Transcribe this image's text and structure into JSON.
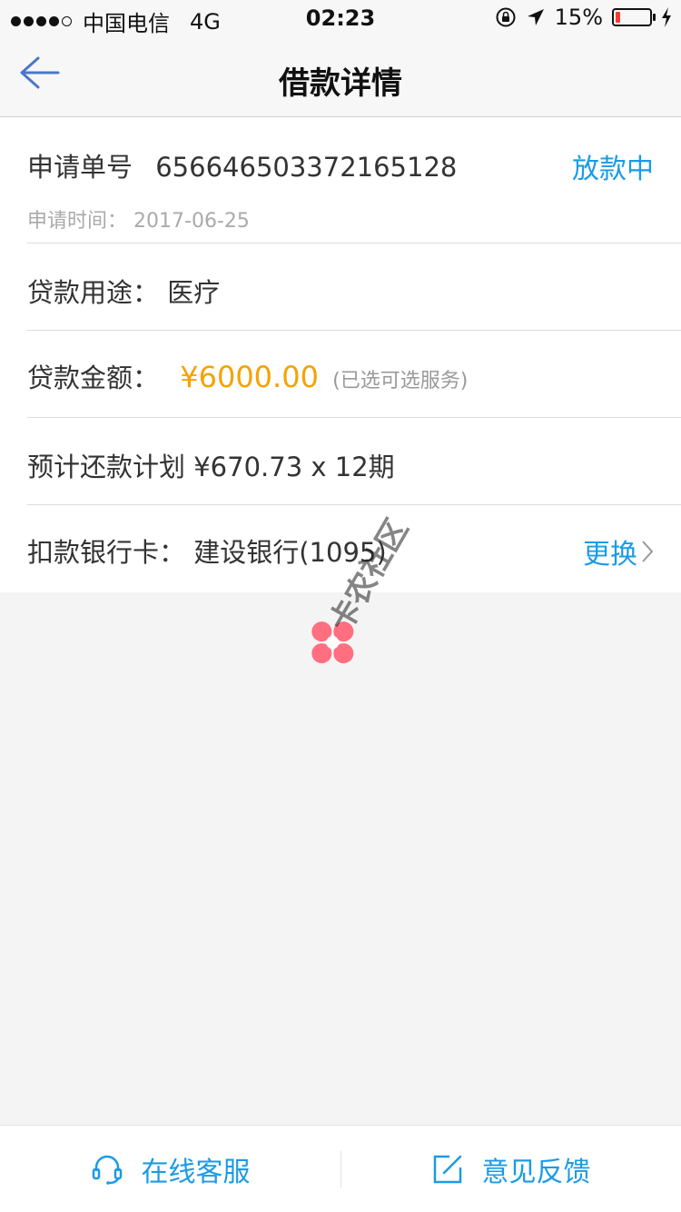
{
  "status_bar": {
    "carrier": "中国电信",
    "network": "4G",
    "time": "02:23",
    "battery_percent_label": "15%",
    "battery_level": 0.15
  },
  "nav": {
    "title": "借款详情"
  },
  "application": {
    "number_label": "申请单号",
    "number": "656646503372165128",
    "status": "放款中",
    "date_label": "申请时间：",
    "date": "2017-06-25"
  },
  "loan": {
    "purpose_label": "贷款用途：",
    "purpose": "医疗",
    "amount_label": "贷款金额：",
    "amount": "¥6000.00",
    "amount_note": "(已选可选服务)",
    "plan_label": "预计还款计划",
    "plan": "¥670.73 x 12期",
    "bank_label": "扣款银行卡：",
    "bank": "建设银行(1095)",
    "change_label": "更换"
  },
  "watermark": {
    "text": "卡农社区"
  },
  "bottom_bar": {
    "service_label": "在线客服",
    "feedback_label": "意见反馈"
  },
  "colors": {
    "accent": "#1a9be6",
    "amount": "#f5a200",
    "battery_low": "#ff3b30"
  }
}
